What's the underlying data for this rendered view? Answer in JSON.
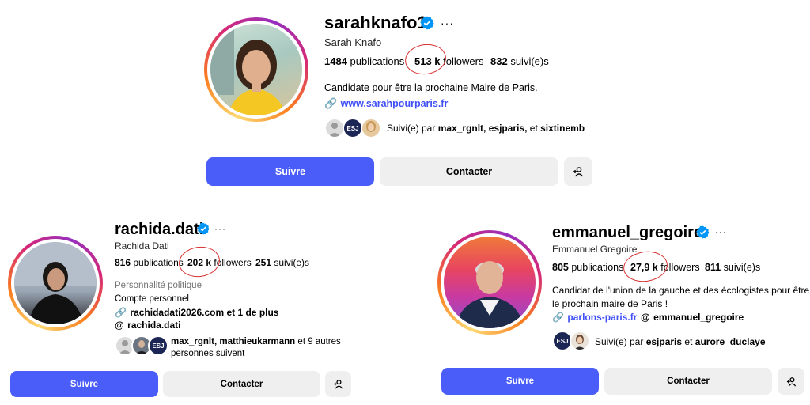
{
  "profiles": [
    {
      "username": "sarahknafo1",
      "fullname": "Sarah Knafo",
      "publications_count": "1484",
      "publications_label": "publications",
      "followers_count": "513 k",
      "followers_label": "followers",
      "following_count": "832",
      "following_label": "suivi(e)s",
      "bio": "Candidate pour être la prochaine Maire de Paris.",
      "link": "www.sarahpourparis.fr",
      "followed_by_prefix": "Suivi(e) par",
      "followed_by_names": "max_rgnlt, esjparis,",
      "followed_by_and": "et",
      "followed_by_last": "sixtinemb",
      "follow_button": "Suivre",
      "contact_button": "Contacter"
    },
    {
      "username": "rachida.dati",
      "fullname": "Rachida Dati",
      "publications_count": "816",
      "publications_label": "publications",
      "followers_count": "202 k",
      "followers_label": "followers",
      "following_count": "251",
      "following_label": "suivi(e)s",
      "category": "Personnalité politique",
      "bio": "Compte personnel",
      "link": "rachidadati2026.com et 1 de plus",
      "threads": "rachida.dati",
      "followed_by_names": "max_rgnlt, matthieukarmann",
      "followed_by_rest": "et 9 autres",
      "followed_by_line2": "personnes suivent",
      "follow_button": "Suivre",
      "contact_button": "Contacter"
    },
    {
      "username": "emmanuel_gregoire",
      "fullname": "Emmanuel Gregoire",
      "publications_count": "805",
      "publications_label": "publications",
      "followers_count": "27,9 k",
      "followers_label": "followers",
      "following_count": "811",
      "following_label": "suivi(e)s",
      "bio_line1": "Candidat de l'union de la gauche et des écologistes pour être",
      "bio_line2": "le prochain maire de Paris !",
      "link": "parlons-paris.fr",
      "threads": "emmanuel_gregoire",
      "followed_by_prefix": "Suivi(e) par",
      "followed_by_first": "esjparis",
      "followed_by_and": "et",
      "followed_by_last": "aurore_duclaye",
      "follow_button": "Suivre",
      "contact_button": "Contacter"
    }
  ],
  "esj_badge": "ESJ",
  "colors": {
    "accent": "#4a5df9",
    "verified": "#0095f6",
    "link": "#4150f7",
    "annotation": "#d63030"
  }
}
